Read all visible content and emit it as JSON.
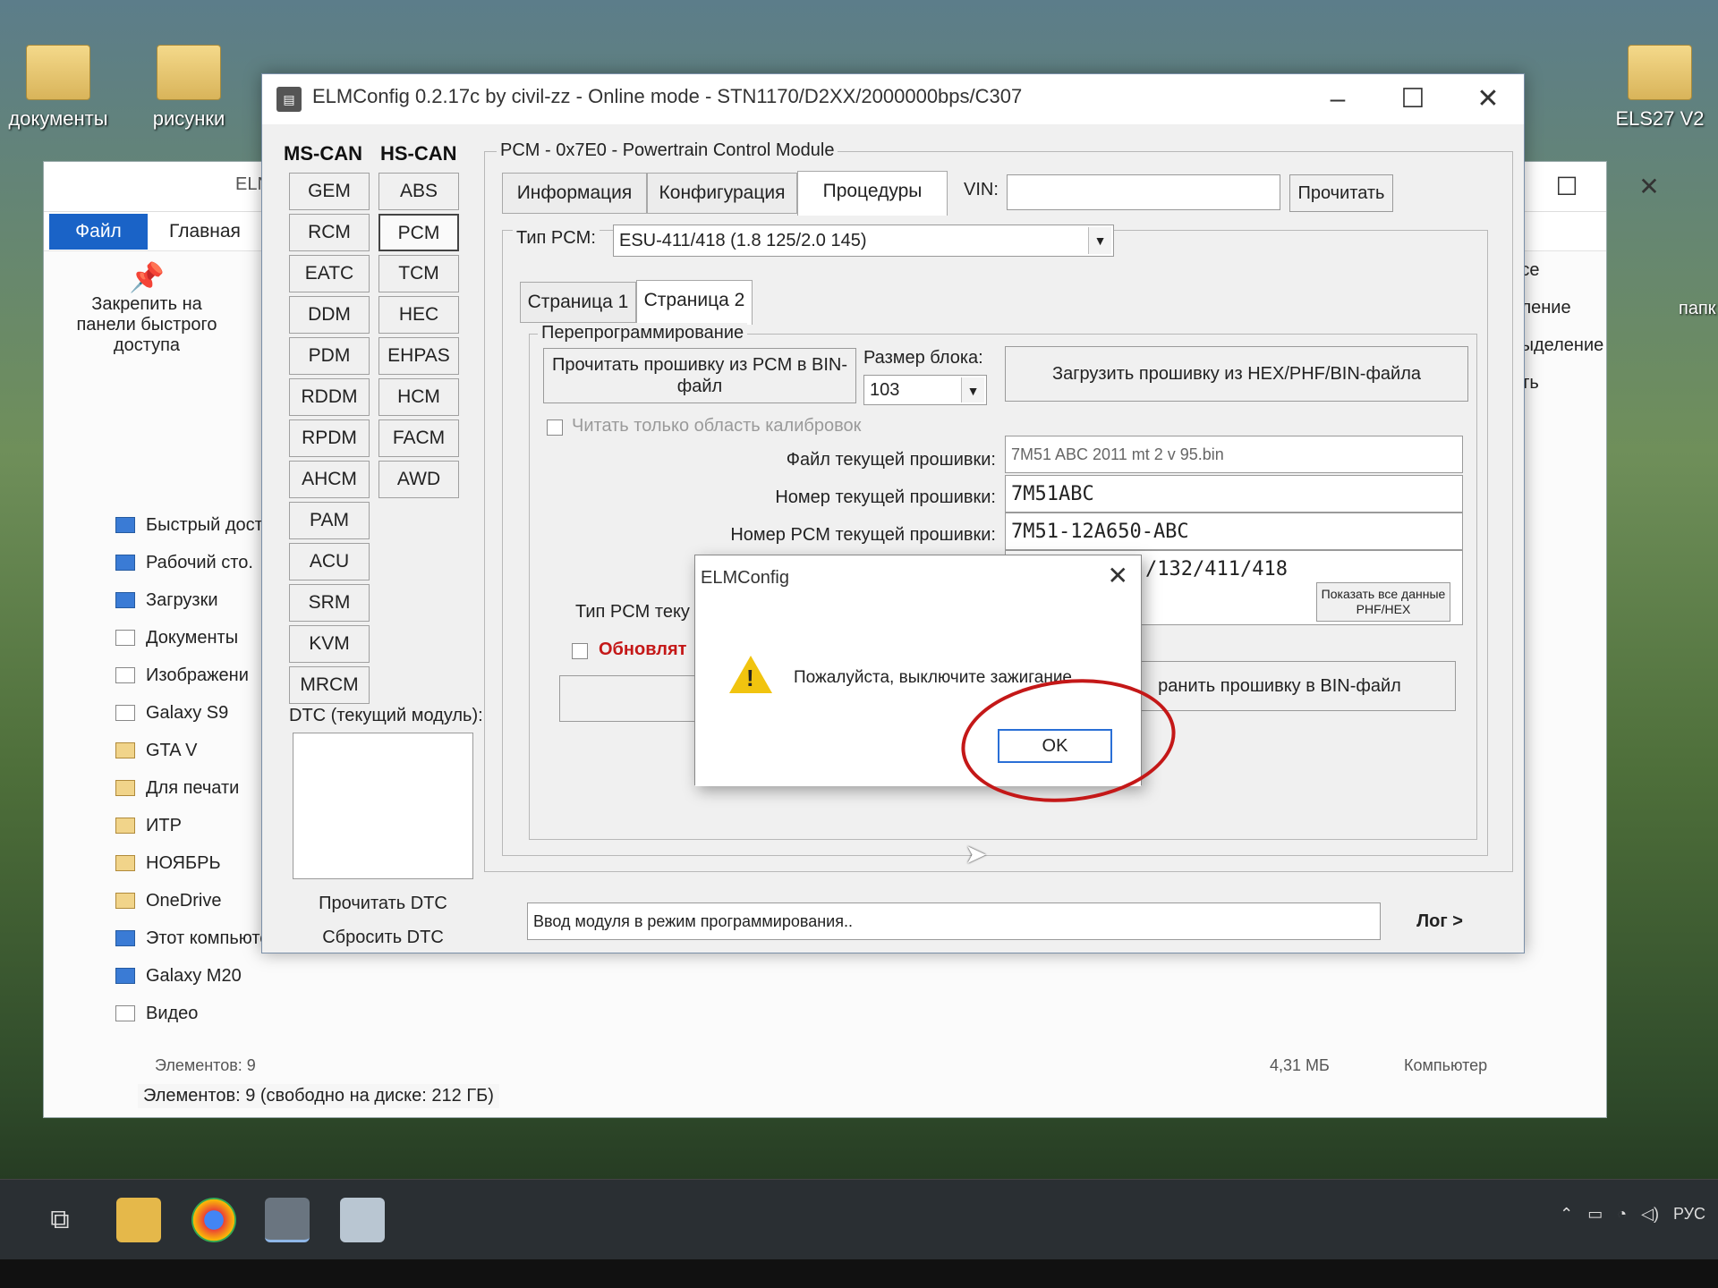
{
  "desktop": {
    "icons": [
      {
        "label": "документы"
      },
      {
        "label": "рисунки"
      },
      {
        "label": "ELS27 V2"
      }
    ]
  },
  "explorer": {
    "title_fragment": "ELN",
    "tabs": {
      "file": "Файл",
      "home": "Главная"
    },
    "pin_label": "Закрепить на панели быстрого доступа",
    "nav_items": [
      "Быстрый досту",
      "Рабочий сто.",
      "Загрузки",
      "Документы",
      "Изображени",
      "Galaxy S9",
      "GTA V",
      "Для печати",
      "ИТР",
      "НОЯБРЬ",
      "OneDrive",
      "Этот компьютер",
      "Galaxy M20",
      "Видео"
    ],
    "right_items": [
      "все",
      "еление",
      "выделение",
      "ить"
    ],
    "right_side_label": "папк",
    "items_count": "Элементов: 9",
    "size_text": "4,31 МБ",
    "computer_label": "Компьютер",
    "status_bar": "Элементов: 9 (свободно на диске: 212 ГБ)"
  },
  "elm": {
    "title": "ELMConfig 0.2.17c by civil-zz - Online mode - STN1170/D2XX/2000000bps/C307",
    "ms_can_label": "MS-CAN",
    "hs_can_label": "HS-CAN",
    "ms_can_modules": [
      "GEM",
      "RCM",
      "EATC",
      "DDM",
      "PDM",
      "RDDM",
      "RPDM",
      "AHCM",
      "PAM",
      "ACU",
      "SRM",
      "KVM",
      "MRCM"
    ],
    "hs_can_modules": [
      "ABS",
      "PCM",
      "TCM",
      "HEC",
      "EHPAS",
      "HCM",
      "FACM",
      "AWD"
    ],
    "active_module": "PCM",
    "module_group_title": "PCM - 0x7E0 - Powertrain Control Module",
    "tabs": [
      "Информация",
      "Конфигурация",
      "Процедуры"
    ],
    "active_tab": "Процедуры",
    "vin_label": "VIN:",
    "vin_value": "",
    "read_button": "Прочитать",
    "pcm_type_label": "Тип PCM:",
    "pcm_type_value": "ESU-411/418 (1.8 125/2.0 145)",
    "subtabs": [
      "Страница 1",
      "Страница 2"
    ],
    "active_subtab": "Страница 2",
    "reprogram_legend": "Перепрограммирование",
    "read_firmware_button": "Прочитать прошивку из PCM в BIN-файл",
    "block_size_label": "Размер блока:",
    "block_size_value": "103",
    "load_firmware_button": "Загрузить прошивку из HEX/PHF/BIN-файла",
    "calib_only_label": "Читать только область калибровок",
    "current_file_label": "Файл текущей прошивки:",
    "current_file_value": "7M51 ABC 2011 mt 2 v 95.bin",
    "current_number_label": "Номер текущей прошивки:",
    "current_number_value": "7M51ABC",
    "pcm_number_label": "Номер PCM текущей прошивки:",
    "pcm_number_value": "7M51-12A650-ABC",
    "pcm_type_fw_value": "/132/411/418",
    "pcm_type_fw_label": "Тип PCM теку",
    "show_all_button": "Показать все данные PHF/HEX",
    "update_label": "Обновлят",
    "save_firmware_button": "ранить прошивку в BIN-файл",
    "dtc_label": "DTC (текущий модуль):",
    "read_dtc_button": "Прочитать DTC",
    "reset_dtc_button": "Сбросить DTC",
    "status_text": "Ввод модуля в режим программирования..",
    "log_button": "Лог >"
  },
  "dialog": {
    "title": "ELMConfig",
    "message": "Пожалуйста, выключите зажигание",
    "ok_label": "OK",
    "close_glyph": "✕"
  },
  "taskbar": {
    "tray_lang": "РУС",
    "colors": {
      "accent": "#2a6fd6",
      "annotation": "#c41818"
    }
  }
}
